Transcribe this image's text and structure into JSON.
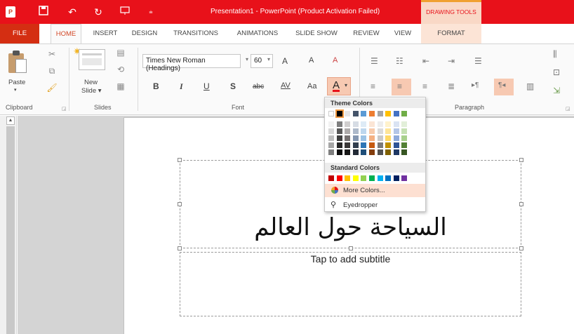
{
  "titlebar": {
    "app_icon": "P",
    "title": "Presentation1 - PowerPoint (Product Activation Failed)",
    "contextual_label": "DRAWING TOOLS",
    "qat": [
      {
        "name": "save-icon",
        "glyph": "🖫"
      },
      {
        "name": "undo-icon",
        "glyph": "↶"
      },
      {
        "name": "redo-icon",
        "glyph": "↻"
      },
      {
        "name": "presenter-icon",
        "glyph": "⎚"
      },
      {
        "name": "customize-qat-icon",
        "glyph": "⩧"
      }
    ]
  },
  "tabs": {
    "file": "FILE",
    "items": [
      "HOME",
      "INSERT",
      "DESIGN",
      "TRANSITIONS",
      "ANIMATIONS",
      "SLIDE SHOW",
      "REVIEW",
      "VIEW",
      "FORMAT"
    ],
    "active": "HOME"
  },
  "ribbon": {
    "clipboard": {
      "label": "Clipboard",
      "paste": "Paste",
      "paste_arrow": "▾"
    },
    "slides": {
      "label": "Slides",
      "new_slide_line1": "New",
      "new_slide_line2": "Slide ▾"
    },
    "font": {
      "label": "Font",
      "font_name": "Times New Roman (Headings)",
      "font_size": "60",
      "grow": "A",
      "shrink": "A",
      "clear": "A",
      "bold": "B",
      "italic": "I",
      "underline": "U",
      "shadow": "S",
      "strike": "abc",
      "spacing": "AV",
      "case": "Aa",
      "font_color": "A",
      "font_color_value": "#e8111a"
    },
    "paragraph": {
      "label": "Paragraph"
    }
  },
  "color_menu": {
    "theme_heading": "Theme Colors",
    "standard_heading": "Standard Colors",
    "more_colors": "More Colors...",
    "eyedropper": "Eyedropper",
    "theme_top_row": [
      "#ffffff",
      "#000000",
      "#e7e6e6",
      "#44546a",
      "#5b9bd5",
      "#ed7d31",
      "#a5a5a5",
      "#ffc000",
      "#4472c4",
      "#70ad47"
    ],
    "theme_shades": [
      [
        "#f2f2f2",
        "#7f7f7f",
        "#d0cece",
        "#d6dce4",
        "#deebf6",
        "#fbe5d5",
        "#ededed",
        "#fff2cc",
        "#dae3f3",
        "#e2efd9"
      ],
      [
        "#d8d8d8",
        "#595959",
        "#aeabab",
        "#adb9ca",
        "#bdd7ee",
        "#f7cbac",
        "#dbdbdb",
        "#fee599",
        "#b4c6e7",
        "#c5e0b3"
      ],
      [
        "#bfbfbf",
        "#3f3f3f",
        "#757070",
        "#8496b0",
        "#9cc3e5",
        "#f4b183",
        "#c9c9c9",
        "#ffd965",
        "#8eaadb",
        "#a8d08d"
      ],
      [
        "#a5a5a5",
        "#262626",
        "#3a3838",
        "#323f4f",
        "#2e75b5",
        "#c55a11",
        "#7b7b7b",
        "#bf9000",
        "#2f5496",
        "#538135"
      ],
      [
        "#7f7f7f",
        "#0c0c0c",
        "#171616",
        "#222a35",
        "#1e4e79",
        "#833c0b",
        "#525252",
        "#7f6000",
        "#1f3864",
        "#375623"
      ]
    ],
    "standard_colors": [
      "#c00000",
      "#ff0000",
      "#ffc000",
      "#ffff00",
      "#92d050",
      "#00b050",
      "#00b0f0",
      "#0070c0",
      "#002060",
      "#7030a0"
    ]
  },
  "slide": {
    "title": "السياحة حول العالم",
    "subtitle_placeholder": "Tap to add subtitle"
  }
}
